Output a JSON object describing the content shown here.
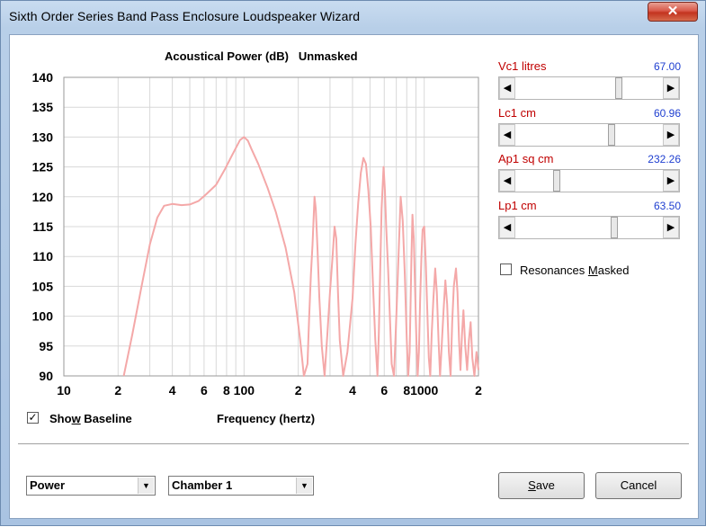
{
  "window": {
    "title": "Sixth Order Series Band Pass Enclosure Loudspeaker Wizard",
    "close_glyph": "✕"
  },
  "chart_title": {
    "name": "Acoustical Power (dB)",
    "mode": "Unmasked"
  },
  "chart_data": {
    "type": "line",
    "title": "Acoustical Power (dB)   Unmasked",
    "xlabel": "Frequency (hertz)",
    "ylabel": "",
    "xscale": "log",
    "xlim": [
      10,
      2000
    ],
    "ylim": [
      90,
      140
    ],
    "grid": true,
    "y_ticks": [
      140,
      135,
      130,
      125,
      120,
      115,
      110,
      105,
      100,
      95,
      90
    ],
    "x_ticks": [
      {
        "value": 10,
        "label": "10"
      },
      {
        "value": 20,
        "label": "2"
      },
      {
        "value": 40,
        "label": "4"
      },
      {
        "value": 60,
        "label": "6"
      },
      {
        "value": 80,
        "label": "8"
      },
      {
        "value": 100,
        "label": "100"
      },
      {
        "value": 200,
        "label": "2"
      },
      {
        "value": 400,
        "label": "4"
      },
      {
        "value": 600,
        "label": "6"
      },
      {
        "value": 800,
        "label": "8"
      },
      {
        "value": 1000,
        "label": "1000"
      },
      {
        "value": 2000,
        "label": "2"
      }
    ],
    "line_color": "#f4a8a8",
    "series": [
      {
        "x": [
          21.5,
          24,
          27,
          30,
          33,
          36,
          40,
          45,
          50,
          56,
          62,
          70,
          78,
          86,
          95,
          100,
          105,
          110,
          120,
          135,
          150,
          170,
          190,
          205,
          215,
          225,
          230,
          235,
          240,
          246,
          250,
          256,
          262,
          270,
          280,
          290,
          300,
          310,
          318,
          325,
          332,
          340,
          355,
          375,
          400,
          415,
          430,
          445,
          460,
          475,
          490,
          505,
          520,
          535,
          550,
          560,
          570,
          580,
          595,
          605,
          615,
          630,
          645,
          660,
          680,
          700,
          720,
          740,
          760,
          780,
          800,
          815,
          830,
          840,
          850,
          860,
          875,
          890,
          905,
          920,
          935,
          950,
          965,
          980,
          1000,
          1020,
          1040,
          1060,
          1080,
          1100,
          1125,
          1150,
          1175,
          1200,
          1225,
          1250,
          1280,
          1310,
          1340,
          1370,
          1400,
          1430,
          1460,
          1500,
          1530,
          1560,
          1590,
          1620,
          1650,
          1690,
          1730,
          1770,
          1810,
          1850,
          1900,
          1950,
          2000
        ],
        "y": [
          90,
          97,
          105,
          112,
          116.5,
          118.5,
          118.8,
          118.6,
          118.7,
          119.3,
          120.5,
          122,
          124.5,
          127,
          129.5,
          130,
          129.4,
          128,
          125.5,
          121.5,
          117.5,
          111.5,
          104,
          96,
          90,
          92,
          100,
          107,
          112,
          120,
          118,
          111,
          103,
          95,
          90,
          97,
          104,
          110,
          115,
          113,
          104,
          96,
          90,
          94,
          103,
          112,
          119,
          124,
          126.5,
          125.5,
          121,
          115,
          105,
          96,
          90,
          97,
          108,
          118,
          125,
          121,
          115,
          108,
          100,
          92,
          90,
          100,
          110,
          120,
          116,
          107,
          96,
          90,
          94,
          102,
          110,
          117,
          113,
          104,
          96,
          90,
          94,
          103,
          110,
          114.5,
          115,
          109,
          101,
          93,
          90,
          97,
          103,
          108,
          104,
          96,
          90,
          95,
          101,
          106,
          102,
          94,
          90,
          99,
          105,
          108,
          104,
          96,
          91,
          97,
          101,
          95,
          91,
          96,
          99,
          93,
          90,
          94,
          91
        ]
      }
    ]
  },
  "params": [
    {
      "label": "Vc1  litres",
      "value": "67.00",
      "fraction": 0.71
    },
    {
      "label": "Lc1  cm",
      "value": "60.96",
      "fraction": 0.66
    },
    {
      "label": "Ap1  sq cm",
      "value": "232.26",
      "fraction": 0.27
    },
    {
      "label": "Lp1  cm",
      "value": "63.50",
      "fraction": 0.68
    }
  ],
  "scroll_arrows": {
    "left": "◀",
    "right": "▶"
  },
  "resonances": {
    "label_pre": "Resonances ",
    "label_u": "M",
    "label_post": "asked",
    "checked": false
  },
  "baseline": {
    "label_pre": "Sho",
    "label_u": "w",
    "label_post": " Baseline",
    "checked": true,
    "check_glyph": "✓"
  },
  "frequency_label": "Frequency (hertz)",
  "combos": {
    "mode": {
      "value": "Power"
    },
    "chamber": {
      "value": "Chamber 1"
    },
    "arrow": "▼"
  },
  "buttons": {
    "save": {
      "u": "S",
      "rest": "ave"
    },
    "cancel": {
      "label": "Cancel"
    }
  }
}
